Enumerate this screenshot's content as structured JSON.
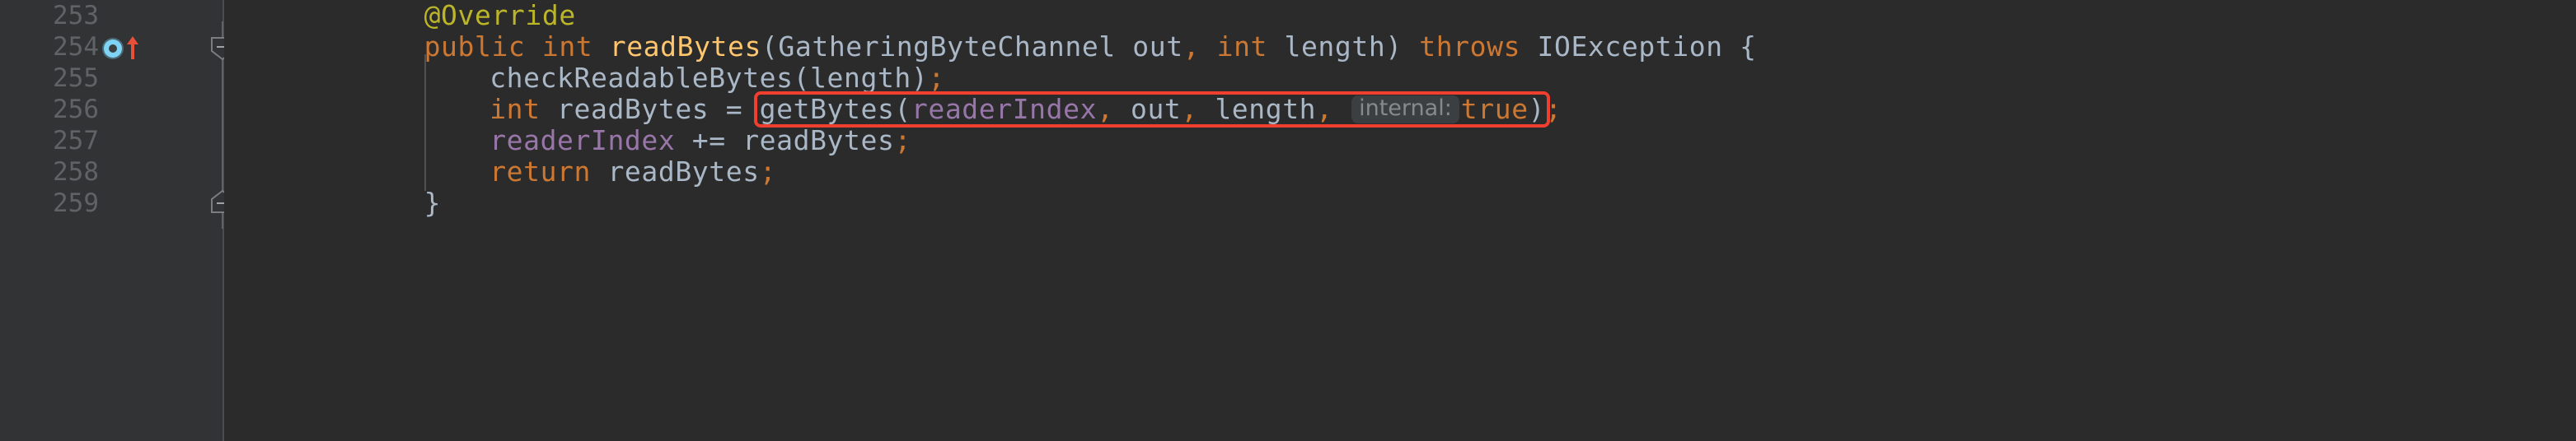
{
  "editor": {
    "theme_name": "darcula",
    "colors": {
      "editor_background": "#2b2b2b",
      "gutter_background": "#313335",
      "line_number": "#606366",
      "annotation": "#bbb529",
      "keyword": "#cc7832",
      "method": "#ffc66d",
      "plain_text": "#a9b7c6",
      "field": "#9876aa",
      "inlay_hint_background": "#3c3f41",
      "inlay_hint_text": "#868a8c",
      "highlight_box": "#f03e2f",
      "override_marker": "#7fd4f5",
      "indent_guide": "#4e5254"
    },
    "gutter": {
      "markers": [
        {
          "line": "254",
          "icon": "override-method-icon",
          "tooltip_name": "overriding-method-marker"
        },
        {
          "line": "254",
          "icon": "arrow-up-icon",
          "tooltip_name": "navigate-to-super-method"
        },
        {
          "line": "254",
          "icon": "fold-collapse-icon"
        },
        {
          "line": "259",
          "icon": "fold-collapse-end-icon"
        }
      ]
    },
    "lines": [
      {
        "number": "253",
        "indent": 4,
        "text": "@Override",
        "tokens": [
          {
            "t": "@Override",
            "c": "anno"
          }
        ]
      },
      {
        "number": "254",
        "indent": 4,
        "text": "public int readBytes(GatheringByteChannel out, int length) throws IOException {",
        "tokens": [
          {
            "t": "public",
            "c": "kw"
          },
          {
            "t": " ",
            "c": "plain"
          },
          {
            "t": "int",
            "c": "kw"
          },
          {
            "t": " ",
            "c": "plain"
          },
          {
            "t": "readBytes",
            "c": "method"
          },
          {
            "t": "(GatheringByteChannel out",
            "c": "plain"
          },
          {
            "t": ",",
            "c": "comma"
          },
          {
            "t": " ",
            "c": "plain"
          },
          {
            "t": "int",
            "c": "kw"
          },
          {
            "t": " length)",
            "c": "plain"
          },
          {
            "t": " ",
            "c": "plain"
          },
          {
            "t": "throws",
            "c": "kw"
          },
          {
            "t": " IOException {",
            "c": "plain"
          }
        ]
      },
      {
        "number": "255",
        "indent": 8,
        "text": "checkReadableBytes(length);",
        "tokens": [
          {
            "t": "checkReadableBytes(length)",
            "c": "plain"
          },
          {
            "t": ";",
            "c": "semi"
          }
        ]
      },
      {
        "number": "256",
        "indent": 8,
        "text": "int readBytes = getBytes(readerIndex, out, length, internal: true);",
        "tokens": [
          {
            "t": "int",
            "c": "kw"
          },
          {
            "t": " readBytes ",
            "c": "plain"
          },
          {
            "t": "=",
            "c": "plain"
          },
          {
            "t": " getBytes(",
            "c": "plain"
          },
          {
            "t": "readerIndex",
            "c": "field"
          },
          {
            "t": ",",
            "c": "comma"
          },
          {
            "t": " out",
            "c": "plain"
          },
          {
            "t": ",",
            "c": "comma"
          },
          {
            "t": " length",
            "c": "plain"
          },
          {
            "t": ",",
            "c": "comma"
          },
          {
            "t": " ",
            "c": "plain"
          },
          {
            "t": "internal:",
            "c": "inlay"
          },
          {
            "t": "true",
            "c": "kw"
          },
          {
            "t": ")",
            "c": "plain"
          },
          {
            "t": ";",
            "c": "semi"
          }
        ],
        "highlight_box": true,
        "highlight_label": "getBytes-call-highlight"
      },
      {
        "number": "257",
        "indent": 8,
        "text": "readerIndex += readBytes;",
        "tokens": [
          {
            "t": "readerIndex",
            "c": "field"
          },
          {
            "t": " += readBytes",
            "c": "plain"
          },
          {
            "t": ";",
            "c": "semi"
          }
        ]
      },
      {
        "number": "258",
        "indent": 8,
        "text": "return readBytes;",
        "tokens": [
          {
            "t": "return",
            "c": "kw"
          },
          {
            "t": " readBytes",
            "c": "plain"
          },
          {
            "t": ";",
            "c": "semi"
          }
        ]
      },
      {
        "number": "259",
        "indent": 4,
        "text": "}",
        "tokens": [
          {
            "t": "}",
            "c": "plain"
          }
        ]
      }
    ]
  }
}
